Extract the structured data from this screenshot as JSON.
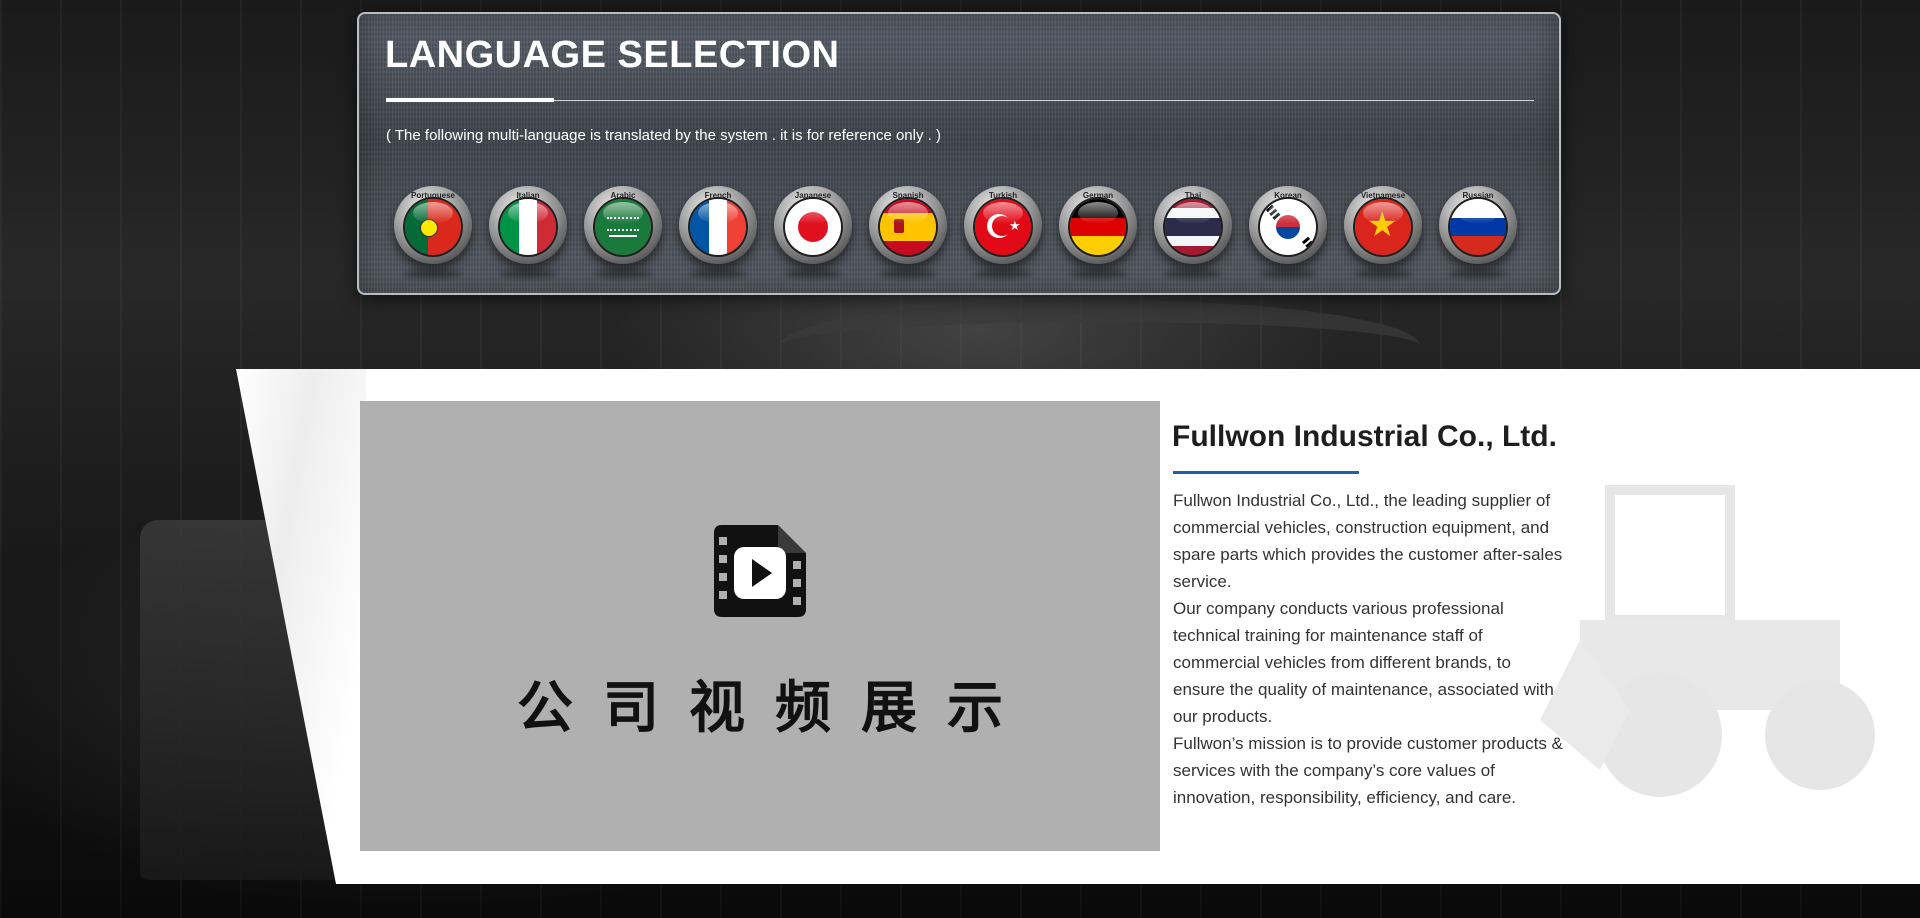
{
  "language_panel": {
    "title": "LANGUAGE SELECTION",
    "note": "( The following multi-language is translated by the system . it is for reference only . )",
    "languages": [
      {
        "label": "Portuguese",
        "flag": "portugal-flag-icon"
      },
      {
        "label": "Italian",
        "flag": "italy-flag-icon"
      },
      {
        "label": "Arabic",
        "flag": "saudi-arabia-flag-icon"
      },
      {
        "label": "French",
        "flag": "france-flag-icon"
      },
      {
        "label": "Japanese",
        "flag": "japan-flag-icon"
      },
      {
        "label": "Spanish",
        "flag": "spain-flag-icon"
      },
      {
        "label": "Turkish",
        "flag": "turkey-flag-icon"
      },
      {
        "label": "German",
        "flag": "germany-flag-icon"
      },
      {
        "label": "Thai",
        "flag": "thailand-flag-icon"
      },
      {
        "label": "Korean",
        "flag": "korea-flag-icon"
      },
      {
        "label": "Vietnamese",
        "flag": "vietnam-flag-icon"
      },
      {
        "label": "Russian",
        "flag": "russia-flag-icon"
      }
    ]
  },
  "video": {
    "icon": "film-play-icon",
    "caption": "公司视频展示"
  },
  "company": {
    "title": "Fullwon Industrial Co., Ltd.",
    "paragraphs": [
      "Fullwon Industrial Co., Ltd., the leading supplier of commercial vehicles, construction equipment, and spare parts which provides the customer after-sales service.",
      "Our company conducts various professional technical training for maintenance staff of commercial vehicles from different brands, to ensure the quality of maintenance, associated with our products.",
      "Fullwon’s mission is to provide customer products & services with the company’s core values of innovation, responsibility, efficiency, and care."
    ],
    "accent_color": "#1f5ea8"
  }
}
